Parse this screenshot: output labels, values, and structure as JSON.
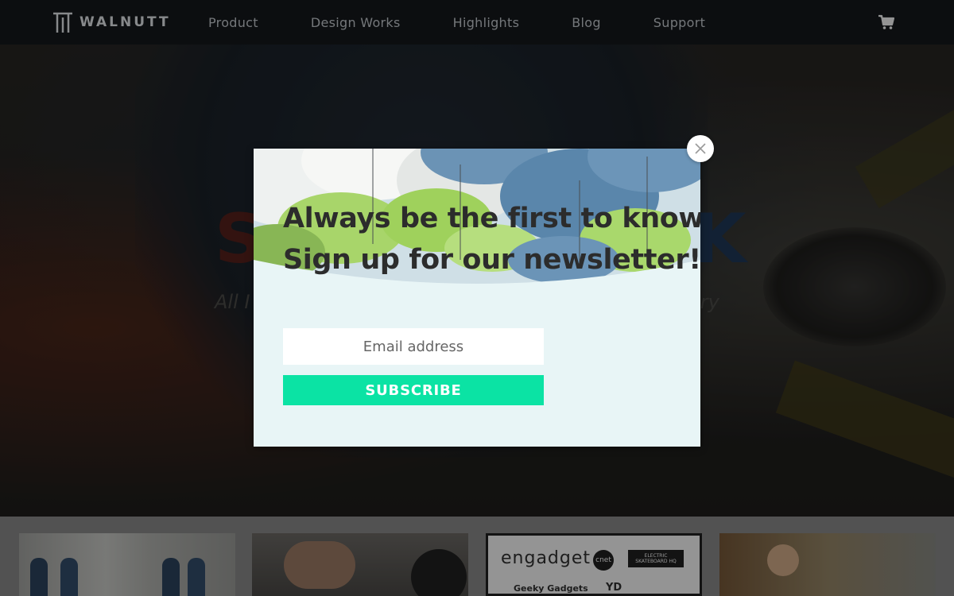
{
  "header": {
    "brand": "WALNUTT",
    "nav": [
      "Product",
      "Design Works",
      "Highlights",
      "Blog",
      "Support"
    ],
    "cart_icon": "cart-icon"
  },
  "hero": {
    "title_start": "S",
    "title_end": "K",
    "subtitle_start": "All I",
    "subtitle_end": "ery"
  },
  "press": {
    "logos": [
      "engadget",
      "cnet",
      "ELECTRIC SKATEBOARD HQ",
      "Geeky Gadgets",
      "YD"
    ]
  },
  "modal": {
    "heading_line1": "Always be the first to know.",
    "heading_line2": "Sign up for our newsletter!",
    "email_placeholder": "Email address",
    "subscribe_label": "SUBSCRIBE",
    "close_icon": "close-icon",
    "colors": {
      "accent": "#0be3a4",
      "background": "#e8f5f6"
    }
  }
}
